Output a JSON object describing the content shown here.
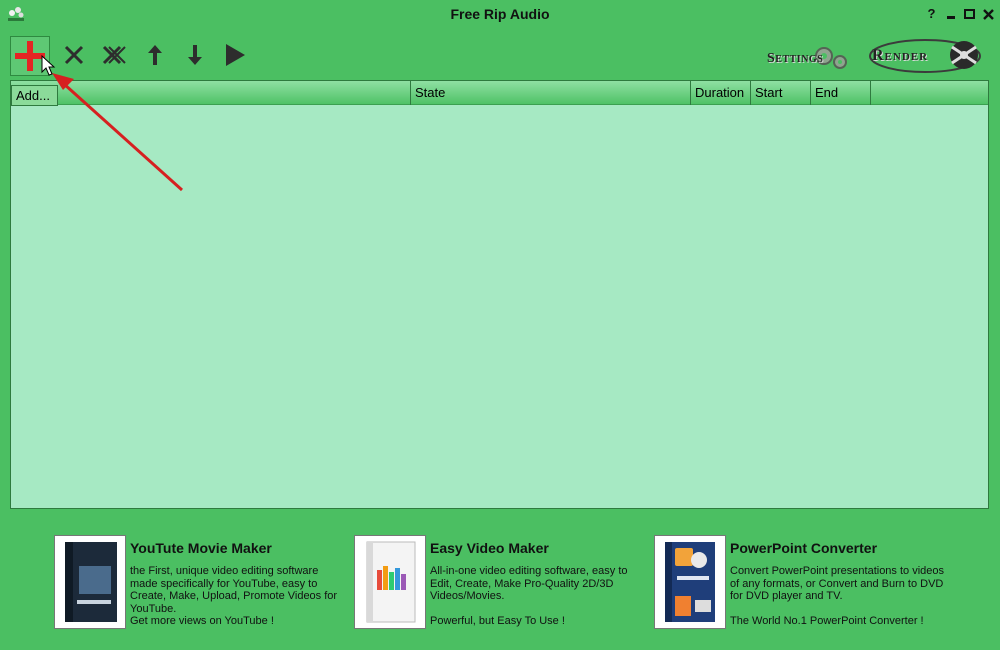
{
  "window": {
    "title": "Free Rip Audio",
    "help_label": "?"
  },
  "toolbar": {
    "settings_label": "Settings",
    "render_label": "Render"
  },
  "list": {
    "add_button": "Add...",
    "columns": [
      "State",
      "Duration",
      "Start",
      "End"
    ]
  },
  "ads": [
    {
      "title": "YouTute Movie Maker",
      "lines": [
        "the First, unique video editing software made specifically for YouTube, easy to Create, Make, Upload, Promote Videos for YouTube.",
        "Get more views on YouTube !"
      ]
    },
    {
      "title": "Easy Video Maker",
      "lines": [
        "All-in-one video editing software, easy to Edit, Create, Make Pro-Quality 2D/3D Videos/Movies.",
        "",
        "Powerful, but Easy To Use !"
      ]
    },
    {
      "title": "PowerPoint Converter",
      "lines": [
        "Convert PowerPoint presentations to videos of any formats, or Convert and Burn to DVD for DVD player and TV.",
        "",
        "The World No.1 PowerPoint Converter !"
      ]
    }
  ],
  "colors": {
    "background": "#4bbf62",
    "list_area": "#a6e9c3",
    "annotation_arrow": "#d62020",
    "add_icon": "#e52424"
  }
}
